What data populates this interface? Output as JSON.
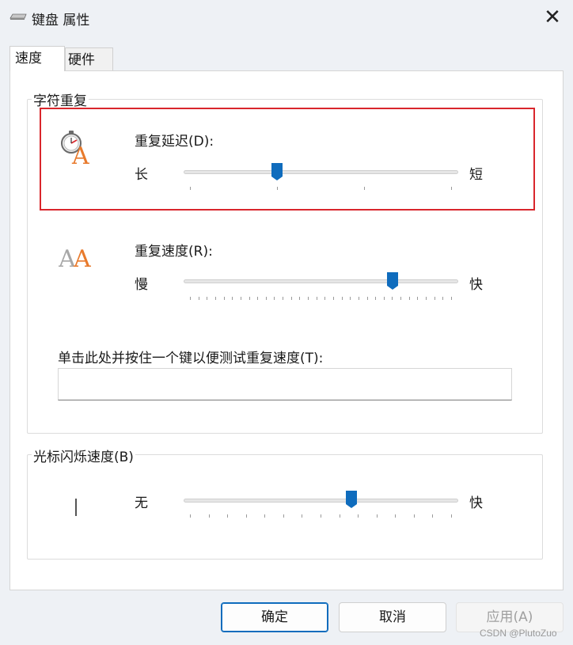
{
  "window": {
    "title": "键盘 属性",
    "close_glyph": "✕"
  },
  "tabs": [
    {
      "label": "速度",
      "selected": true
    },
    {
      "label": "硬件",
      "selected": false
    }
  ],
  "char_repeat": {
    "legend": "字符重复",
    "delay": {
      "label": "重复延迟(D):",
      "min_label": "长",
      "max_label": "短",
      "ticks": 4,
      "value_fraction": 0.333
    },
    "rate": {
      "label": "重复速度(R):",
      "min_label": "慢",
      "max_label": "快",
      "ticks": 32,
      "value_fraction": 0.7742
    },
    "test": {
      "label": "单击此处并按住一个键以便测试重复速度(T):",
      "value": ""
    }
  },
  "cursor_blink": {
    "legend": "光标闪烁速度(B)",
    "min_label": "无",
    "max_label": "快",
    "ticks": 15,
    "value_fraction": 0.6154
  },
  "buttons": {
    "ok": "确定",
    "cancel": "取消",
    "apply": "应用(A)"
  },
  "watermark": "CSDN @PlutoZuo",
  "colors": {
    "accent": "#0f6cbd",
    "highlight_border": "#d9262c"
  },
  "icons": {
    "delay": "stopwatch-letter-a-icon",
    "rate": "double-letter-a-icon",
    "cursor": "text-cursor-icon",
    "keyboard": "keyboard-icon"
  }
}
